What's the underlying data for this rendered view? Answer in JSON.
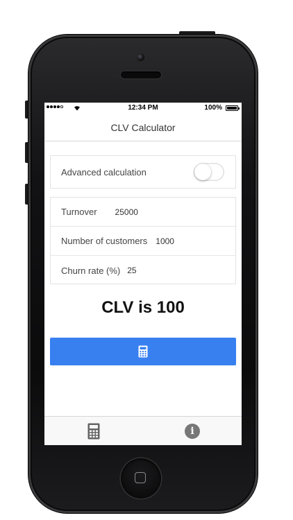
{
  "status_bar": {
    "time": "12:34 PM",
    "battery": "100%"
  },
  "header": {
    "title": "CLV Calculator"
  },
  "advanced": {
    "label": "Advanced calculation",
    "enabled": false
  },
  "inputs": [
    {
      "label": "Turnover",
      "value": "25000"
    },
    {
      "label": "Number of customers",
      "value": "1000"
    },
    {
      "label": "Churn rate (%)",
      "value": "25"
    }
  ],
  "result": {
    "text": "CLV is 100"
  },
  "calculate_button": {
    "icon": "calculator-icon",
    "color": "#3880f0"
  },
  "tabs": [
    {
      "icon": "calculator-icon"
    },
    {
      "icon": "info-icon",
      "glyph": "i"
    }
  ]
}
